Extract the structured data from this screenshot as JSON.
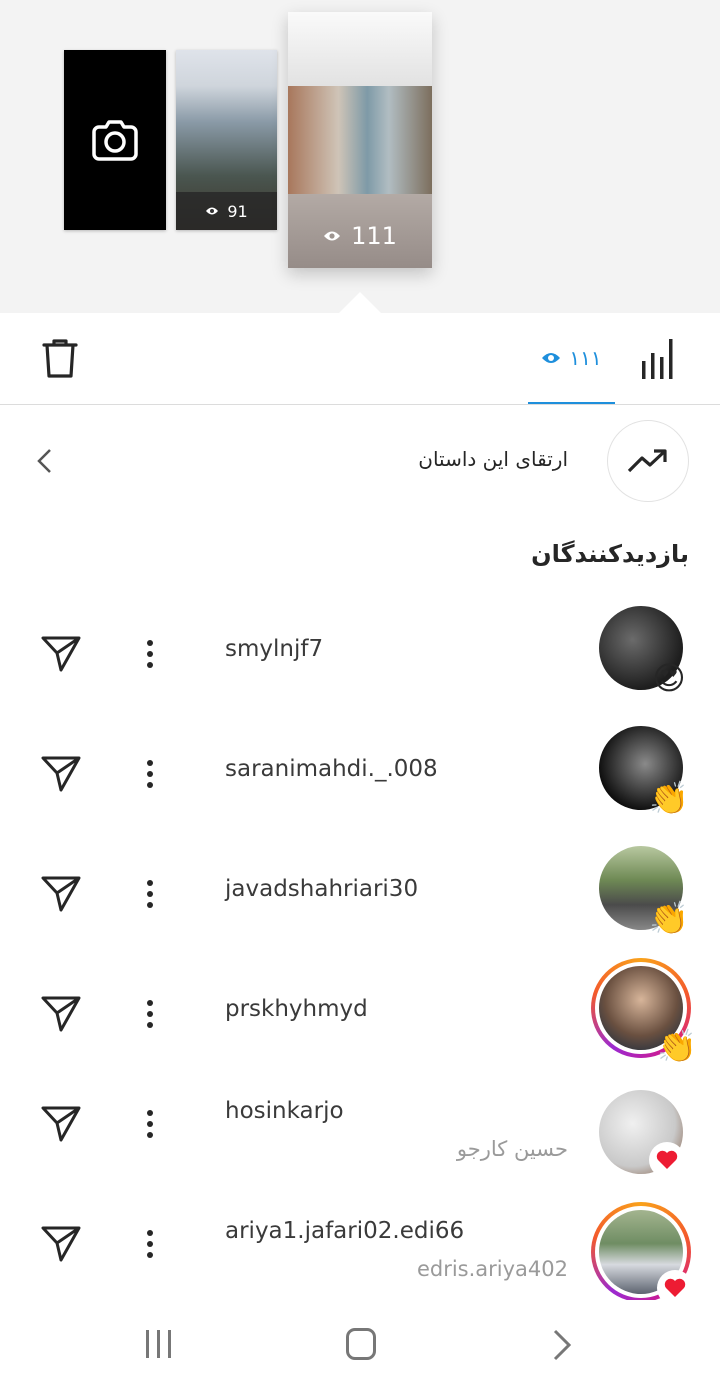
{
  "stories": {
    "camera_icon": "camera-icon",
    "items": [
      {
        "views": "91"
      },
      {
        "views": "111"
      }
    ]
  },
  "toolbar": {
    "views_tab": "١١١",
    "icons": [
      "trash-icon",
      "eye-icon",
      "bar-chart-icon"
    ],
    "accent": "#1e8fdc"
  },
  "progress": {
    "label": "ارتقای این داستان"
  },
  "viewers_title": "بازدیدکنندگان",
  "viewers": [
    {
      "username": "smylnjf7",
      "fullname": "",
      "reaction": "😍"
    },
    {
      "username": "saranimahdi._.008",
      "fullname": "",
      "reaction": "👏"
    },
    {
      "username": "javadshahriari30",
      "fullname": "",
      "reaction": "👏"
    },
    {
      "username": "prskhyhmyd",
      "fullname": "",
      "reaction": "👏"
    },
    {
      "username": "hosinkarjo",
      "fullname": "حسین کارجو",
      "reaction": "❤"
    },
    {
      "username": "ariya1.jafari02.edi66",
      "fullname": "edris.ariya402",
      "reaction": "❤"
    }
  ]
}
